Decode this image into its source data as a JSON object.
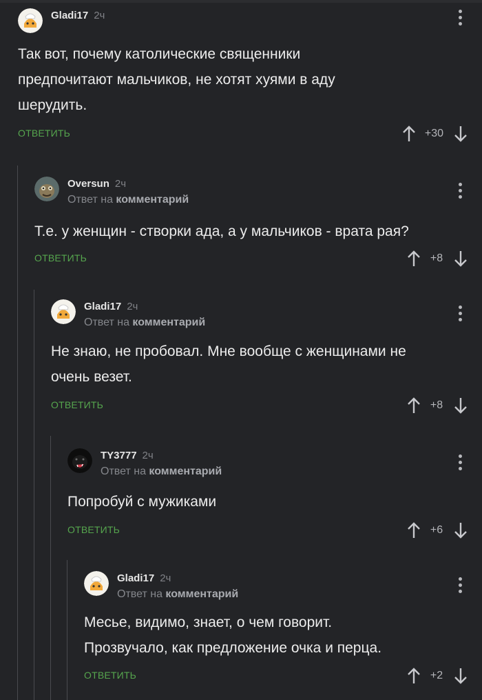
{
  "ui": {
    "reply_label": "ОТВЕТИТЬ",
    "reply_to_prefix": "Ответ на",
    "reply_to_target": "комментарий"
  },
  "comments": [
    {
      "author": "Gladi17",
      "time": "2ч",
      "text_lines": [
        "Так вот, почему католические священники",
        "предпочитают мальчиков, не хотят хуями в аду",
        "шерудить."
      ],
      "rating": "+30",
      "avatar": "chef-cat-avatar"
    },
    {
      "author": "Oversun",
      "time": "2ч",
      "text_lines": [
        "Т.е. у женщин - створки ада, а у мальчиков - врата рая?"
      ],
      "rating": "+8",
      "avatar": "creature-avatar"
    },
    {
      "author": "Gladi17",
      "time": "2ч",
      "text_lines": [
        "Не знаю, не пробовал. Мне вообще с женщинами не",
        "очень везет."
      ],
      "rating": "+8",
      "avatar": "chef-cat-avatar"
    },
    {
      "author": "TY3777",
      "time": "2ч",
      "text_lines": [
        "Попробуй с мужиками"
      ],
      "rating": "+6",
      "avatar": "dark-cat-avatar"
    },
    {
      "author": "Gladi17",
      "time": "2ч",
      "text_lines": [
        "Месье, видимо, знает, о чем говорит.",
        "Прозвучало, как предложение очка и перца."
      ],
      "rating": "+2",
      "avatar": "chef-cat-avatar"
    }
  ],
  "colors": {
    "background": "#232427",
    "reply_green": "#56a64e",
    "thread_line": "#4a4b4f"
  }
}
